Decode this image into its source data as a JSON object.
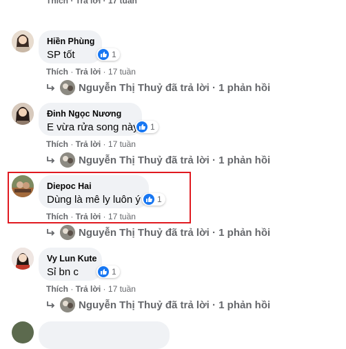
{
  "top_partial": "Thích · Trả lời · 17 tuần",
  "comments": [
    {
      "author": "Hiền Phùng",
      "text": "SP tốt",
      "reaction_count": "1",
      "actions": {
        "like": "Thích",
        "reply": "Trả lời",
        "time": "17 tuần"
      },
      "reply_summary": "Nguyễn Thị Thuỷ đã trả lời · 1 phản hồi"
    },
    {
      "author": "Đinh Ngọc Nương",
      "text": "E vừa rửa song này",
      "reaction_count": "1",
      "actions": {
        "like": "Thích",
        "reply": "Trả lời",
        "time": "17 tuần"
      },
      "reply_summary": "Nguyễn Thị Thuỷ đã trả lời · 1 phản hồi"
    },
    {
      "author": "Diepoc Hai",
      "text": "Dùng là mê ly luôn ý",
      "reaction_count": "1",
      "actions": {
        "like": "Thích",
        "reply": "Trả lời",
        "time": "17 tuần"
      },
      "reply_summary": "Nguyễn Thị Thuỷ đã trả lời · 1 phản hồi"
    },
    {
      "author": "Vy Lun Kute",
      "text": "Sỉ bn c",
      "reaction_count": "1",
      "actions": {
        "like": "Thích",
        "reply": "Trả lời",
        "time": "17 tuần"
      },
      "reply_summary": "Nguyễn Thị Thuỷ đã trả lời · 1 phản hồi"
    }
  ],
  "colors": {
    "like_blue": "#1877f2",
    "bubble_bg": "#f0f2f5",
    "highlight_red": "#e0181f"
  }
}
